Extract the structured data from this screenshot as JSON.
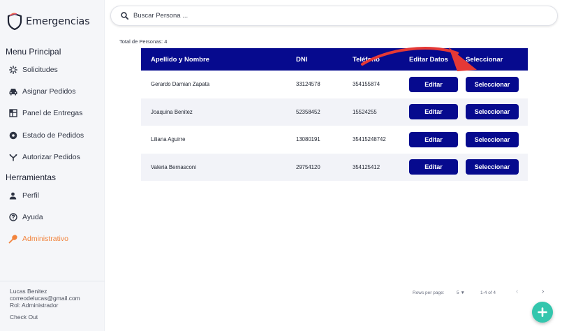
{
  "brand": {
    "name": "Emergencias",
    "icon": "shield-icon"
  },
  "sidebar": {
    "menu_title": "Menu Principal",
    "menu_items": [
      {
        "label": "Solicitudes",
        "icon": "sparkle-icon"
      },
      {
        "label": "Asignar Pedidos",
        "icon": "car-icon"
      },
      {
        "label": "Panel de Entregas",
        "icon": "panel-icon"
      },
      {
        "label": "Estado de Pedidos",
        "icon": "settings-circle-icon"
      },
      {
        "label": "Autorizar Pedidos",
        "icon": "fork-icon"
      }
    ],
    "tools_title": "Herramientas",
    "tools_items": [
      {
        "label": "Perfil",
        "icon": "person-icon"
      },
      {
        "label": "Ayuda",
        "icon": "help-icon"
      },
      {
        "label": "Administrativo",
        "icon": "wrench-icon",
        "active": true
      }
    ],
    "active_color": "#f2833c"
  },
  "user": {
    "name": "Lucas Benitez",
    "email": "correodelucas@gmail.com",
    "role": "Rol: Administrador",
    "checkout": "Check Out"
  },
  "search": {
    "placeholder": "Buscar Persona ..."
  },
  "summary": {
    "total_label": "Total de Personas: 4"
  },
  "table": {
    "header_color": "#060a8e",
    "columns": [
      "Apellido y Nombre",
      "DNI",
      "Teléfono",
      "Editar Datos",
      "Seleccionar"
    ],
    "rows": [
      {
        "name": "Gerardo Damian Zapata",
        "dni": "33124578",
        "phone": "354155874",
        "edit": "Editar",
        "select": "Seleccionar"
      },
      {
        "name": "Joaquina Benitez",
        "dni": "52358452",
        "phone": "15524255",
        "edit": "Editar",
        "select": "Seleccionar"
      },
      {
        "name": "Liliana Aguirre",
        "dni": "13080191",
        "phone": "35415248742",
        "edit": "Editar",
        "select": "Seleccionar"
      },
      {
        "name": "Valeria Bernasconi",
        "dni": "29754120",
        "phone": "354125412",
        "edit": "Editar",
        "select": "Seleccionar"
      }
    ]
  },
  "pagination": {
    "rows_per_page_label": "Rows per page:",
    "rows_per_page_value": "5",
    "range": "1-4 of 4"
  },
  "annotation_color": "#e53935",
  "fab_color": "#33c6ad"
}
